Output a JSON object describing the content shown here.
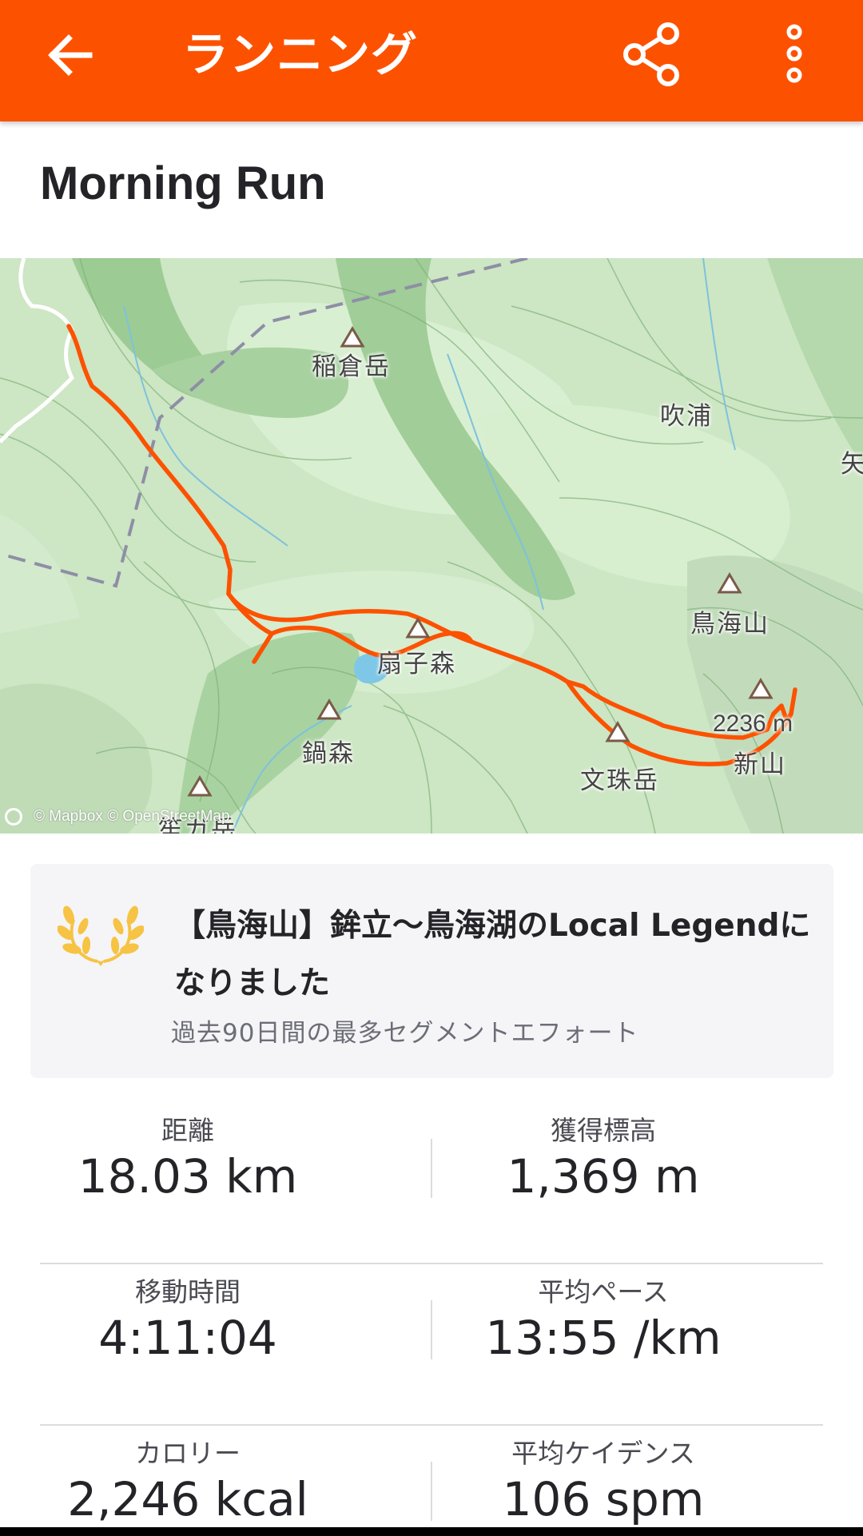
{
  "appbar": {
    "title": "ランニング",
    "back_icon": "arrow-left-icon",
    "share_icon": "share-icon",
    "more_icon": "more-vertical-icon",
    "color": "#fc5200"
  },
  "activity": {
    "title": "Morning Run"
  },
  "map": {
    "labels": {
      "inakura": "稲倉岳",
      "fukiura": "吹浦",
      "chokai": "鳥海山",
      "ougi": "扇子森",
      "nabe": "鍋森",
      "monju": "文珠岳",
      "elev": "2236 m",
      "shinzan": "新山",
      "edge": "矢",
      "bottom": "笙ガ岳"
    },
    "attribution": "© Mapbox © OpenStreetMap",
    "route_color": "#fc5200"
  },
  "legend": {
    "line1": "【鳥海山】鉾立～鳥海湖のLocal Legendになりました",
    "line2": "過去90日間の最多セグメントエフォート",
    "icon": "laurel-icon",
    "icon_color": "#f6c344"
  },
  "stats": {
    "distance_label": "距離",
    "distance_value": "18.03 km",
    "elevation_label": "獲得標高",
    "elevation_value": "1,369 m",
    "moving_time_label": "移動時間",
    "moving_time_value": "4:11:04",
    "pace_label": "平均ペース",
    "pace_value": "13:55 /km",
    "calories_label": "カロリー",
    "calories_value": "2,246 kcal",
    "cadence_label": "平均ケイデンス",
    "cadence_value": "106 spm"
  }
}
